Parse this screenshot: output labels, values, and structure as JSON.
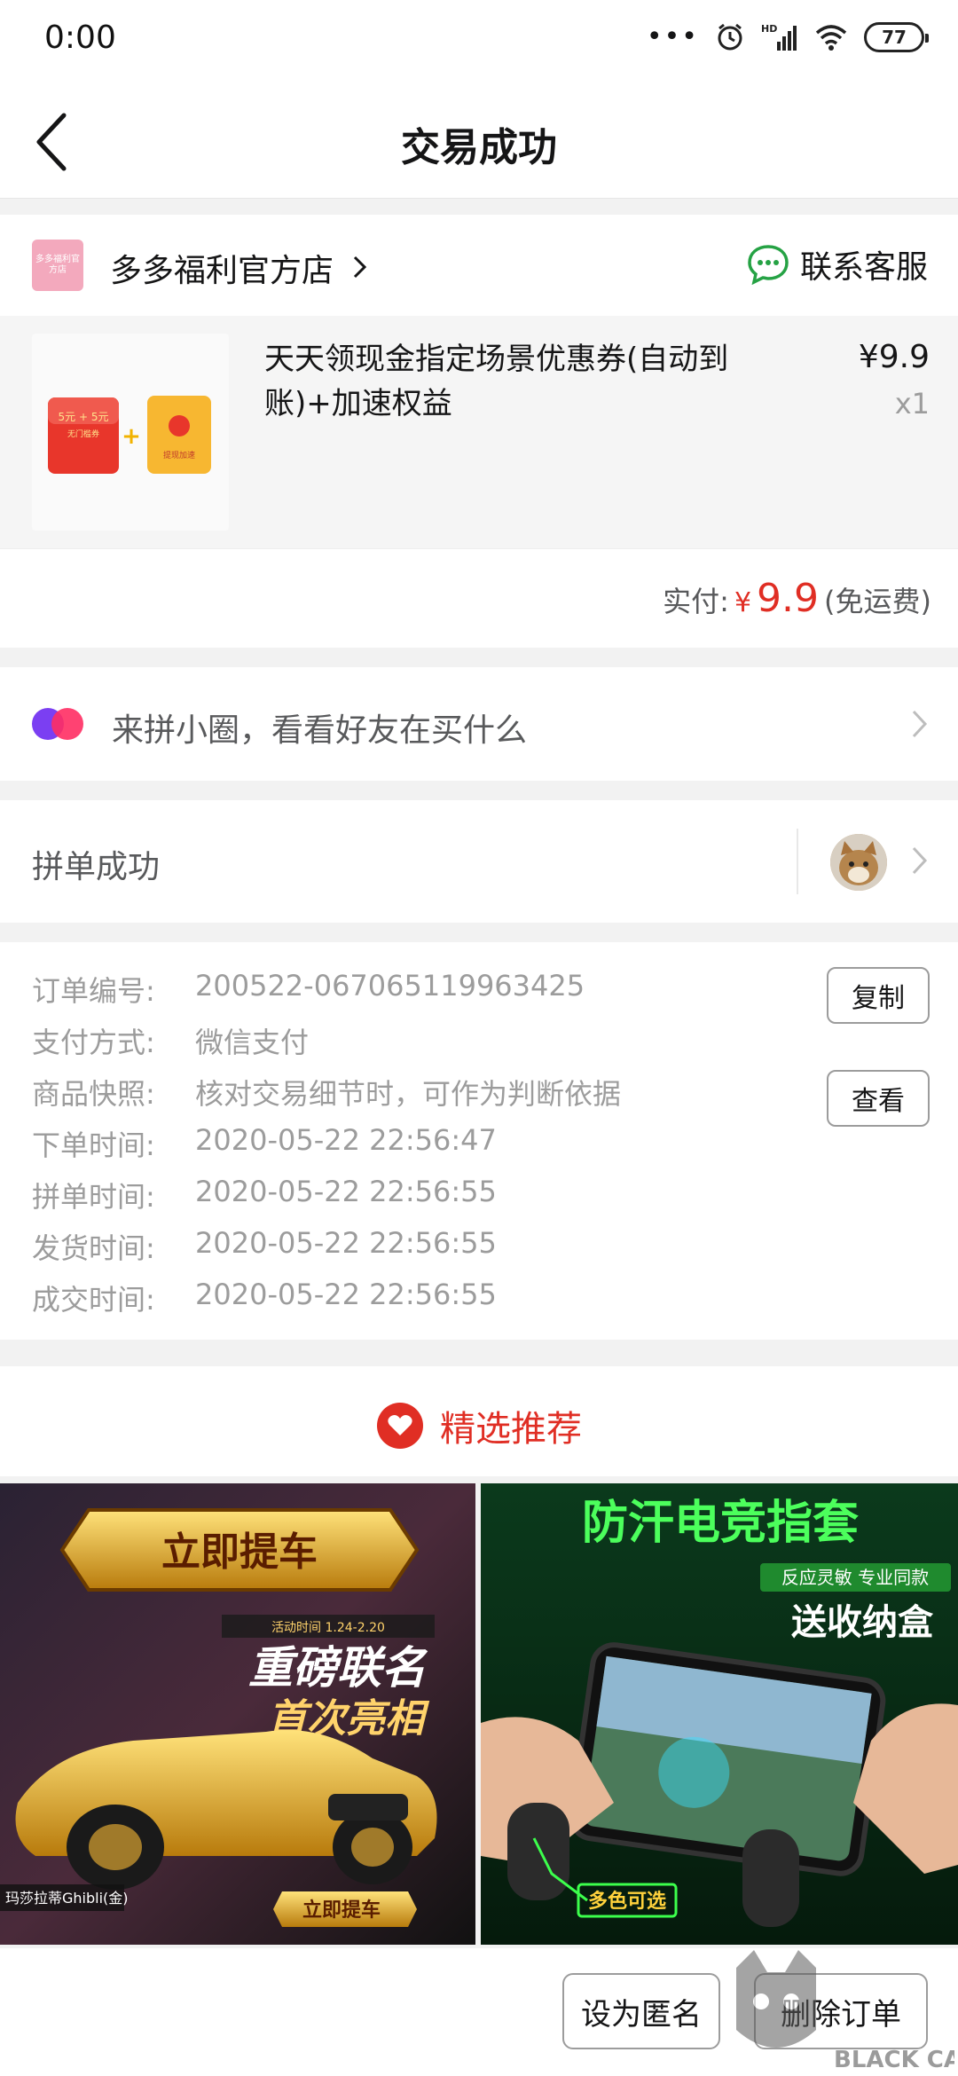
{
  "status_bar": {
    "time": "0:00",
    "battery": "77"
  },
  "nav": {
    "title": "交易成功"
  },
  "store": {
    "logo_text": "多多福利官方店",
    "name": "多多福利官方店",
    "contact_label": "联系客服"
  },
  "product": {
    "name": "天天领现金指定场景优惠券(自动到账)+加速权益",
    "price": "¥9.9",
    "qty": "x1",
    "thumb_coupon_text": "5元 + 5元",
    "thumb_coupon_sub": "无门槛券",
    "thumb_plus": "+",
    "thumb_boost_text": "提现加速"
  },
  "payment": {
    "label": "实付:",
    "currency": "¥",
    "amount": "9.9",
    "note": "(免运费)"
  },
  "circle": {
    "text": "来拼小圈，看看好友在买什么"
  },
  "group": {
    "text": "拼单成功"
  },
  "order_info": {
    "rows": [
      {
        "label": "订单编号:",
        "value": "200522-067065119963425"
      },
      {
        "label": "支付方式:",
        "value": "微信支付"
      },
      {
        "label": "商品快照:",
        "value": "核对交易细节时，可作为判断依据"
      },
      {
        "label": "下单时间:",
        "value": "2020-05-22 22:56:47"
      },
      {
        "label": "拼单时间:",
        "value": "2020-05-22 22:56:55"
      },
      {
        "label": "发货时间:",
        "value": "2020-05-22 22:56:55"
      },
      {
        "label": "成交时间:",
        "value": "2020-05-22 22:56:55"
      }
    ],
    "copy_label": "复制",
    "view_label": "查看"
  },
  "recommend": {
    "title": "精选推荐",
    "left": {
      "banner": "立即提车",
      "date": "活动时间 1.24-2.20",
      "headline1": "重磅联名",
      "headline2": "首次亮相",
      "car_name": "玛莎拉蒂Ghibli(金)",
      "cta": "立即提车"
    },
    "right": {
      "headline": "防汗电竞指套",
      "sub1": "反应灵敏 专业同款",
      "sub2": "送收纳盒",
      "badge": "多色可选"
    }
  },
  "bottom": {
    "anonymous_label": "设为匿名",
    "delete_label": "删除订单",
    "watermark": "BLACK CAT"
  },
  "colors": {
    "accent": "#e02e24",
    "muted": "#9c9c9c",
    "bg": "#f2f2f2"
  }
}
